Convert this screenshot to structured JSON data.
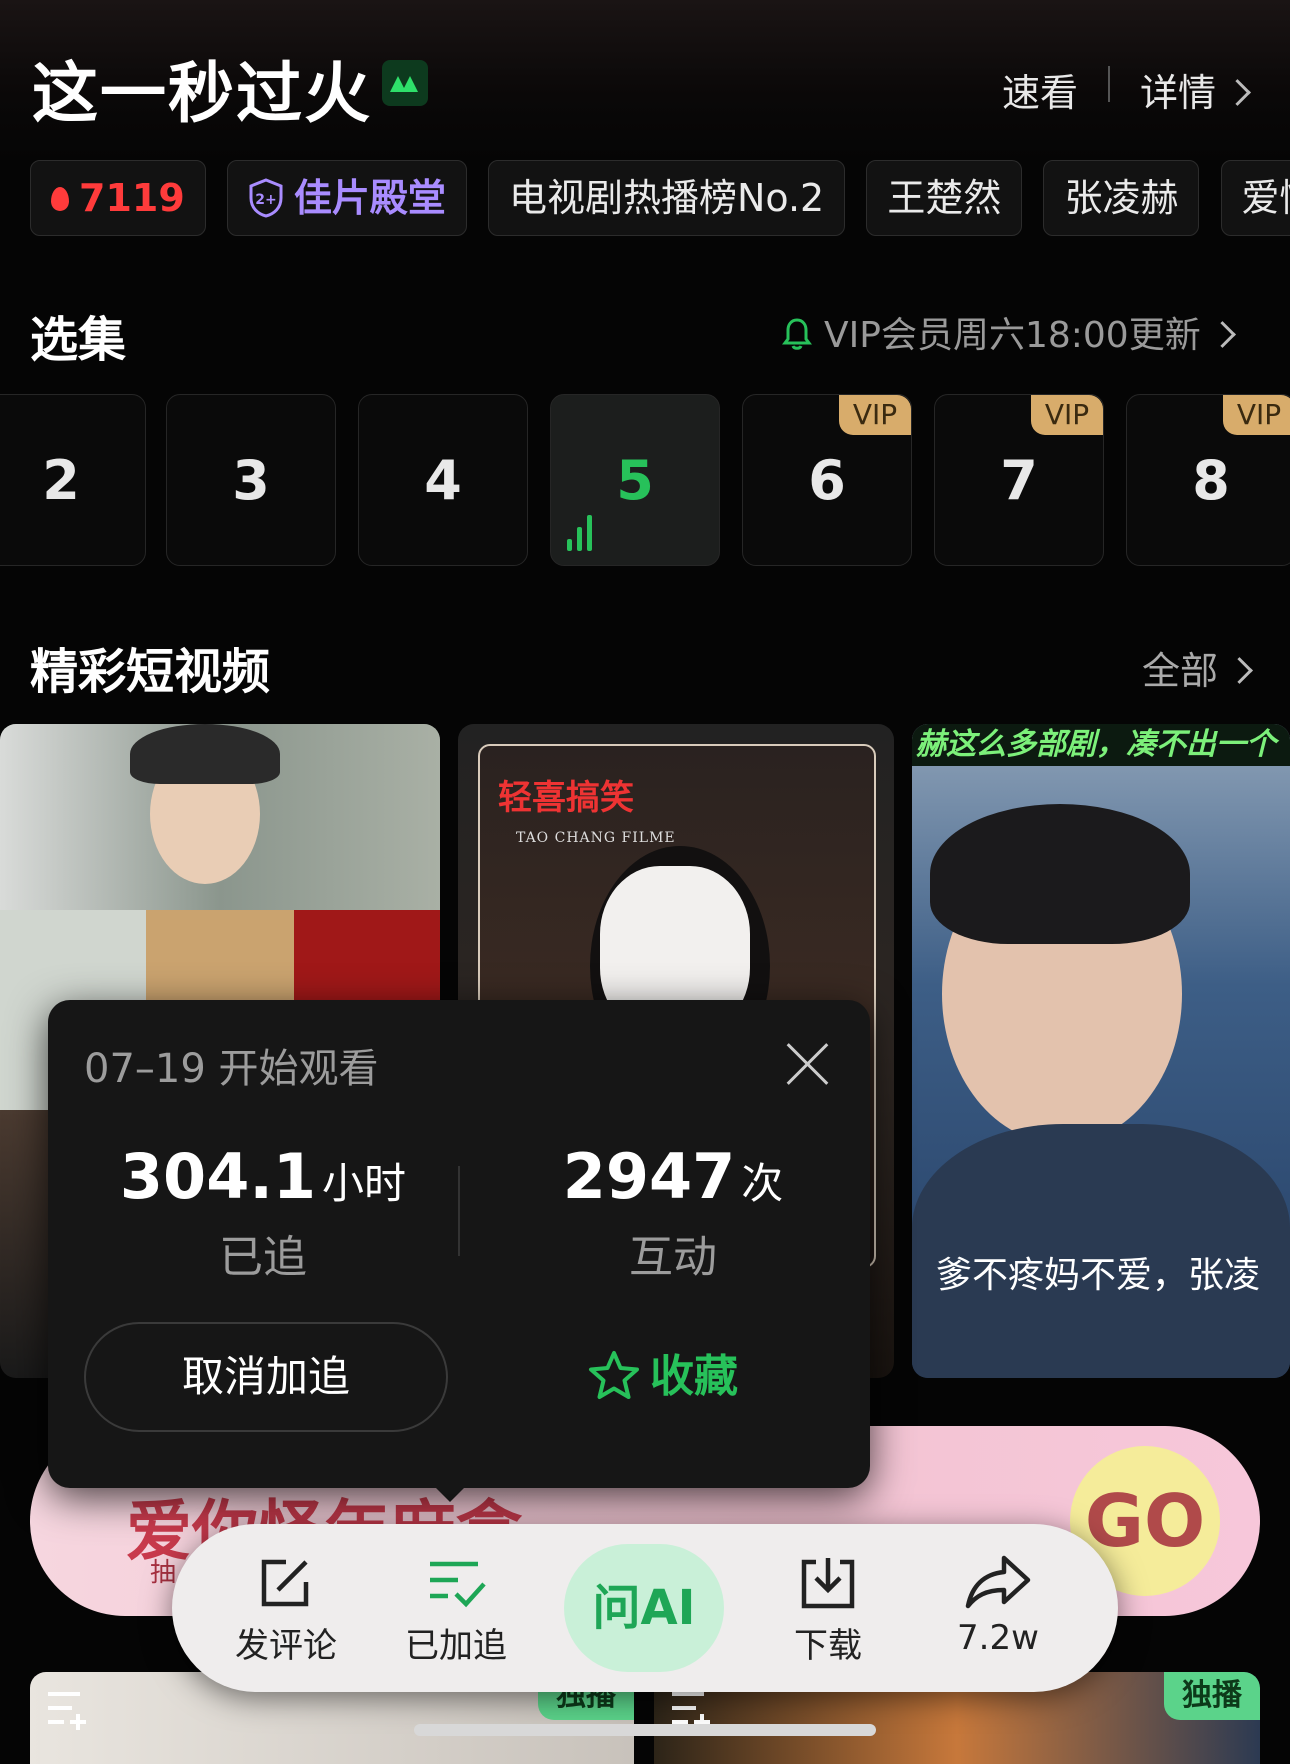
{
  "header": {
    "title": "这一秒过火",
    "quick_view": "速看",
    "detail": "详情"
  },
  "tags": [
    {
      "label": "7119",
      "kind": "hot"
    },
    {
      "label": "佳片殿堂",
      "kind": "hall"
    },
    {
      "label": "电视剧热播榜No.2",
      "kind": "plain"
    },
    {
      "label": "王楚然",
      "kind": "plain"
    },
    {
      "label": "张凌赫",
      "kind": "plain"
    },
    {
      "label": "爱情",
      "kind": "plain"
    }
  ],
  "episodes_section": {
    "title": "选集",
    "update_notice": "VIP会员周六18:00更新",
    "episodes": [
      {
        "num": "2",
        "vip": "",
        "active": false
      },
      {
        "num": "3",
        "vip": "",
        "active": false
      },
      {
        "num": "4",
        "vip": "",
        "active": false
      },
      {
        "num": "5",
        "vip": "",
        "active": true
      },
      {
        "num": "6",
        "vip": "VIP",
        "active": false
      },
      {
        "num": "7",
        "vip": "VIP",
        "active": false
      },
      {
        "num": "8",
        "vip": "VIP",
        "active": false
      }
    ]
  },
  "shorts_section": {
    "title": "精彩短视频",
    "all": "全部",
    "card2_title": "轻喜搞笑",
    "card2_sub": "TAO CHANG FILME",
    "card3_banner": "赫这么多部剧，凑不出一个",
    "card3_caption": "爹不疼妈不爱，张凌"
  },
  "popup": {
    "date_text": "07–19 开始观看",
    "stat1_value": "304.1",
    "stat1_unit": "小时",
    "stat1_label": "已追",
    "stat2_value": "2947",
    "stat2_unit": "次",
    "stat2_label": "互动",
    "cancel_label": "取消加追",
    "favorite_label": "收藏"
  },
  "banner": {
    "text": "爱你怪年麻盒",
    "sub": "抽",
    "go": "GO"
  },
  "toolbar": {
    "comment": "发评论",
    "followed": "已加追",
    "ask_ai": "问AI",
    "download": "下载",
    "share": "7.2w"
  },
  "bottom_cards": {
    "badge1": "独播",
    "badge2": "独播"
  },
  "colors": {
    "accent_green": "#27c15a",
    "hot_red": "#ff3b3b",
    "hall_purple": "#a98cff",
    "vip_gold": "#d8ac6b"
  }
}
